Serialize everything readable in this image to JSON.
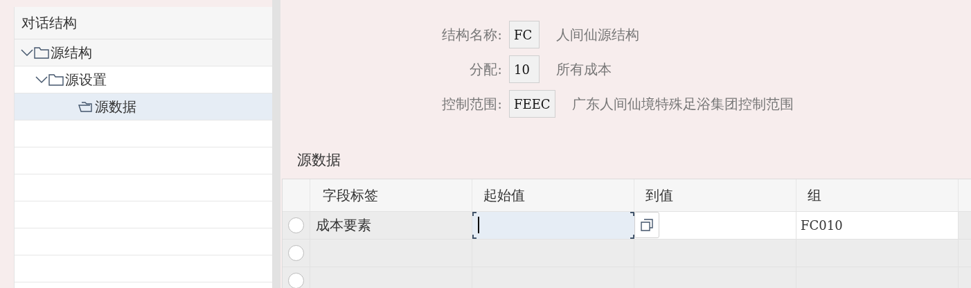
{
  "tree": {
    "title": "对话结构",
    "items": [
      {
        "label": "源结构",
        "expanded": true,
        "selected": false,
        "children": [
          {
            "label": "源设置",
            "expanded": true,
            "selected": false,
            "children": [
              {
                "label": "源数据",
                "selected": true
              }
            ]
          }
        ]
      }
    ]
  },
  "form": [
    {
      "label": "结构名称:",
      "value": "FC",
      "description": "人间仙源结构"
    },
    {
      "label": "分配:",
      "value": "10",
      "description": "所有成本"
    },
    {
      "label": "控制范围:",
      "value": "FEEC",
      "description": "广东人间仙境特殊足浴集团控制范围"
    }
  ],
  "section_title": "源数据",
  "table": {
    "columns": [
      "字段标签",
      "起始值",
      "到值",
      "组"
    ],
    "rows": [
      {
        "kind": "filled",
        "selected": false,
        "field_label": "成本要素",
        "from_focused": true,
        "group": "FC010"
      },
      {
        "kind": "empty",
        "selected": false
      },
      {
        "kind": "empty",
        "selected": false
      }
    ]
  }
}
